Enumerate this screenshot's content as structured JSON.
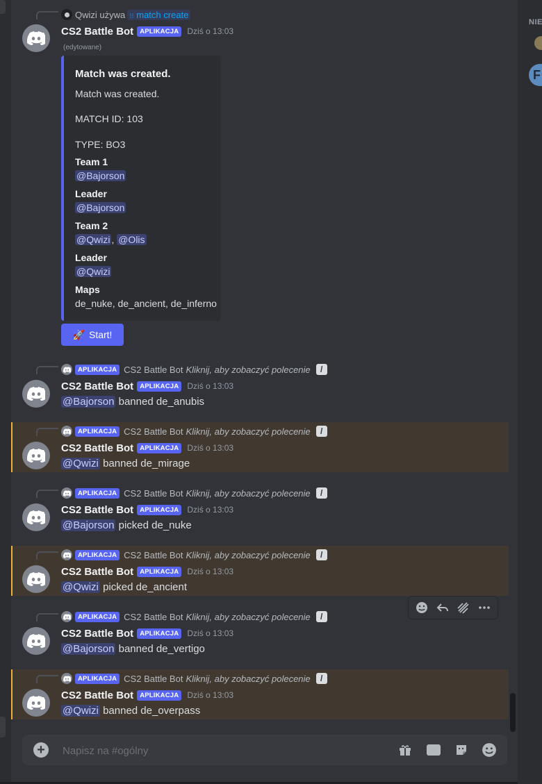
{
  "first_message": {
    "invoker": "Qwizi",
    "used_label": "używa",
    "command": "match create",
    "username": "CS2 Battle Bot",
    "tag": "APLIKACJA",
    "timestamp": "Dziś o 13:03",
    "edited": "(edytowane)",
    "embed": {
      "title": "Match was created.",
      "description": "Match was created.",
      "match_id": "MATCH ID: 103",
      "type": "TYPE: BO3",
      "team1_label": "Team 1",
      "team1_member": "@Bajorson",
      "leader1_label": "Leader",
      "leader1": "@Bajorson",
      "team2_label": "Team 2",
      "team2_member1": "@Qwizi",
      "team2_sep": ",",
      "team2_member2": "@Olis",
      "leader2_label": "Leader",
      "leader2": "@Qwizi",
      "maps_label": "Maps",
      "maps": "de_nuke, de_ancient, de_inferno"
    },
    "start_button": "Start!",
    "start_emoji": "🚀"
  },
  "ref_click_hint": "Kliknij, aby zobaczyć polecenie",
  "messages": [
    {
      "ref_tag": "APLIKACJA",
      "ref_name": "CS2 Battle Bot",
      "username": "CS2 Battle Bot",
      "tag": "APLIKACJA",
      "timestamp": "Dziś o 13:03",
      "mention": "@Bajorson",
      "text": "banned de_anubis",
      "highlight": false
    },
    {
      "ref_tag": "APLIKACJA",
      "ref_name": "CS2 Battle Bot",
      "username": "CS2 Battle Bot",
      "tag": "APLIKACJA",
      "timestamp": "Dziś o 13:03",
      "mention": "@Qwizi",
      "text": "banned de_mirage",
      "highlight": true
    },
    {
      "ref_tag": "APLIKACJA",
      "ref_name": "CS2 Battle Bot",
      "username": "CS2 Battle Bot",
      "tag": "APLIKACJA",
      "timestamp": "Dziś o 13:03",
      "mention": "@Bajorson",
      "text": "picked de_nuke",
      "highlight": false
    },
    {
      "ref_tag": "APLIKACJA",
      "ref_name": "CS2 Battle Bot",
      "username": "CS2 Battle Bot",
      "tag": "APLIKACJA",
      "timestamp": "Dziś o 13:03",
      "mention": "@Qwizi",
      "text": "picked de_ancient",
      "highlight": true
    },
    {
      "ref_tag": "APLIKACJA",
      "ref_name": "CS2 Battle Bot",
      "username": "CS2 Battle Bot",
      "tag": "APLIKACJA",
      "timestamp": "Dziś o 13:03",
      "mention": "@Bajorson",
      "text": "banned de_vertigo",
      "highlight": false
    },
    {
      "ref_tag": "APLIKACJA",
      "ref_name": "CS2 Battle Bot",
      "username": "CS2 Battle Bot",
      "tag": "APLIKACJA",
      "timestamp": "Dziś o 13:03",
      "mention": "@Qwizi",
      "text": "banned de_overpass",
      "highlight": true
    }
  ],
  "hover_toolbar": [
    "add-reaction-icon",
    "reply-icon",
    "thread-icon",
    "more-icon"
  ],
  "composer": {
    "placeholder": "Napisz na #ogólny",
    "gif_label": "GIF",
    "icons": [
      "add-attachment-icon",
      "gift-icon",
      "gif-icon",
      "sticker-icon",
      "emoji-icon"
    ]
  },
  "right_panel": {
    "header": "NIE",
    "avatar_letter": "F"
  },
  "colors": {
    "blurple": "#5865f2",
    "highlight": "#41392f",
    "highlight_border": "#f0b232",
    "mention_bg": "#3c4270"
  }
}
